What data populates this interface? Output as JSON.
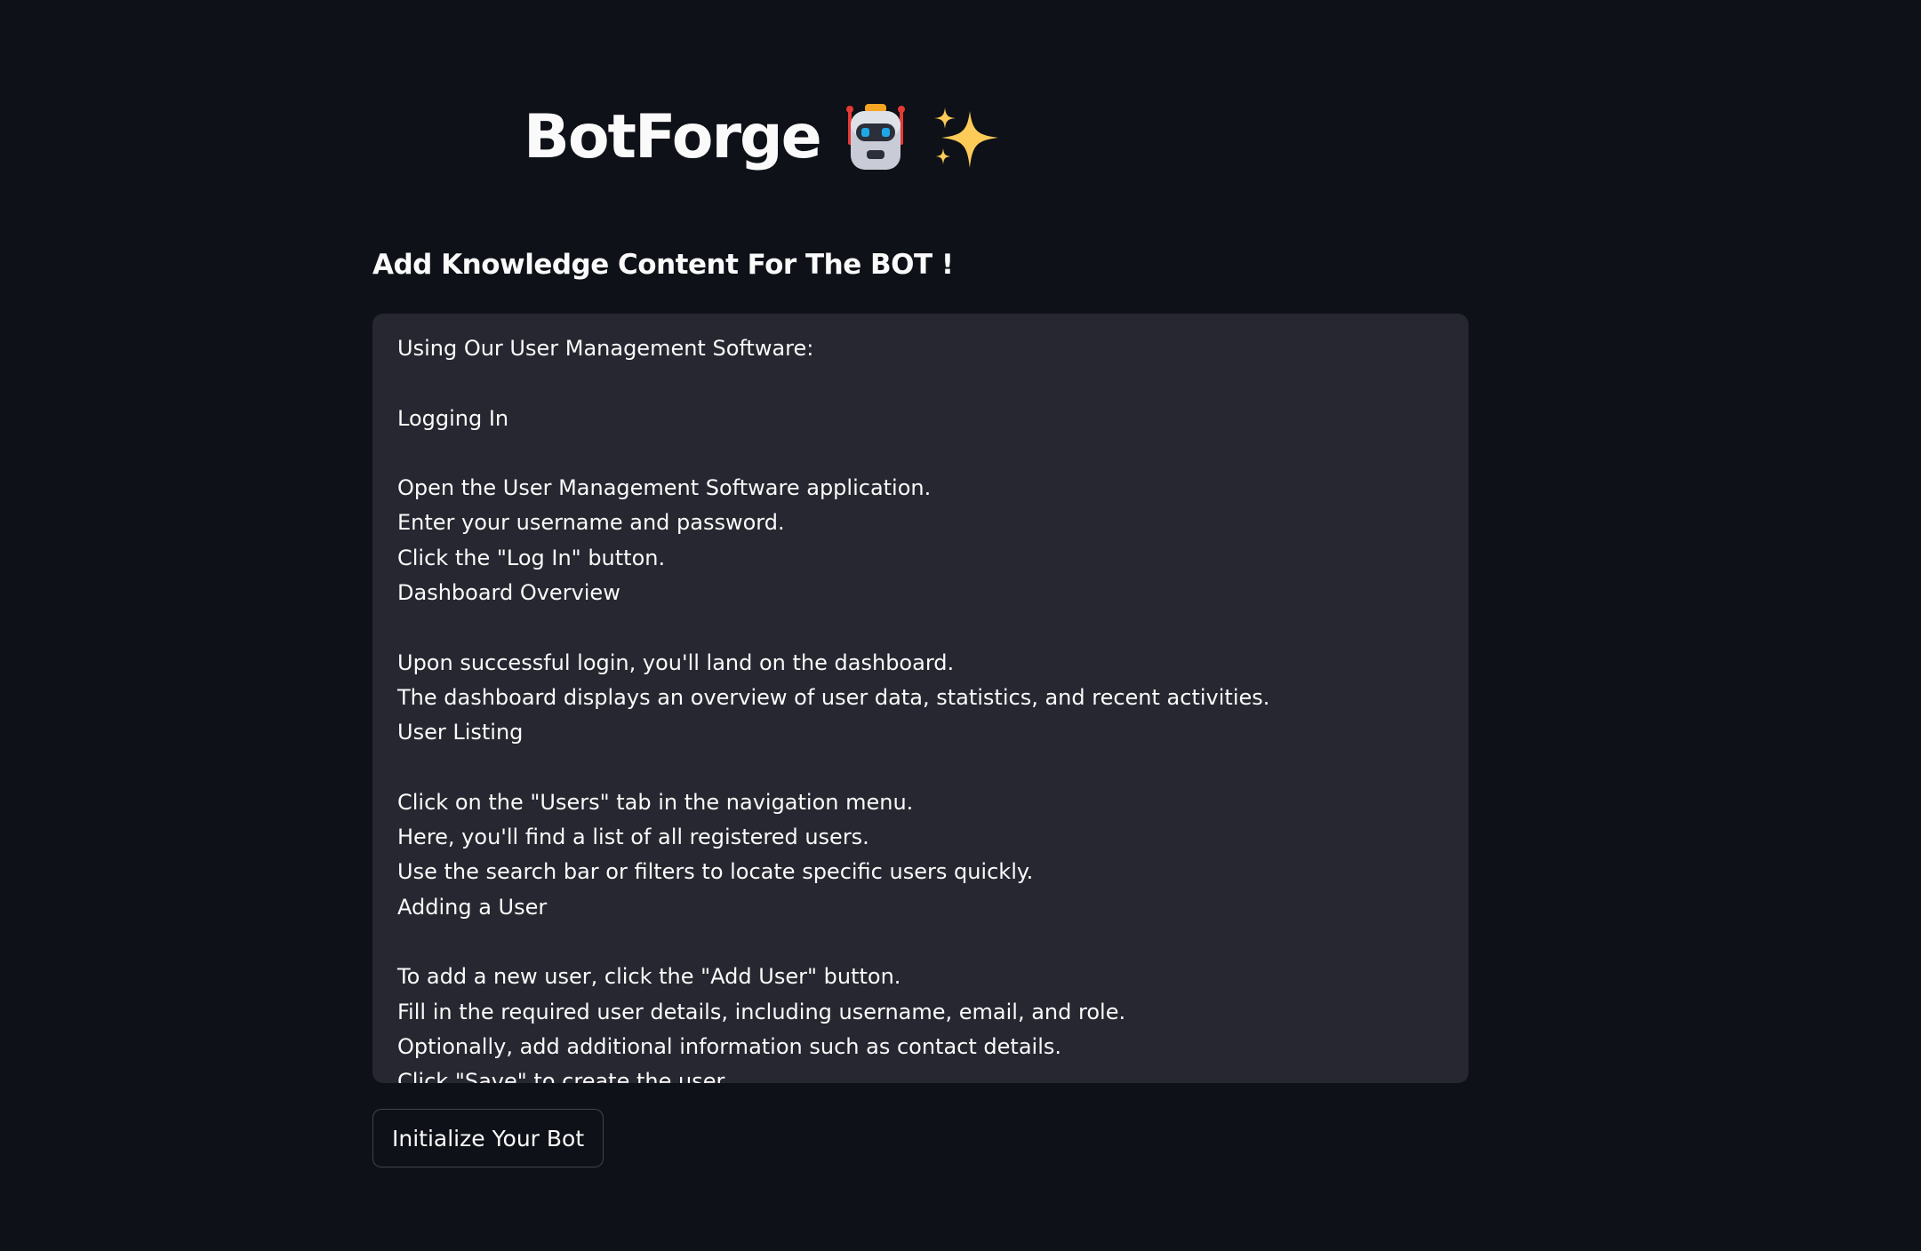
{
  "header": {
    "title": "BotForge",
    "icons": [
      "robot-emoji-icon",
      "sparkles-emoji-icon"
    ]
  },
  "knowledge": {
    "subheader": "Add Knowledge Content For The BOT !",
    "textarea_value": "Using Our User Management Software:\n\nLogging In\n\nOpen the User Management Software application.\nEnter your username and password.\nClick the \"Log In\" button.\nDashboard Overview\n\nUpon successful login, you'll land on the dashboard.\nThe dashboard displays an overview of user data, statistics, and recent activities.\nUser Listing\n\nClick on the \"Users\" tab in the navigation menu.\nHere, you'll find a list of all registered users.\nUse the search bar or filters to locate specific users quickly.\nAdding a User\n\nTo add a new user, click the \"Add User\" button.\nFill in the required user details, including username, email, and role.\nOptionally, add additional information such as contact details.\nClick \"Save\" to create the user."
  },
  "actions": {
    "init_button_label": "Initialize Your Bot"
  },
  "colors": {
    "background": "#0e1117",
    "input_background": "#262730",
    "text": "#fafafa",
    "robot_body": "#c9ccd6",
    "robot_eyes": "#1fa8e8",
    "robot_antenna": "#e53935",
    "sparkle": "#fdcb58"
  }
}
